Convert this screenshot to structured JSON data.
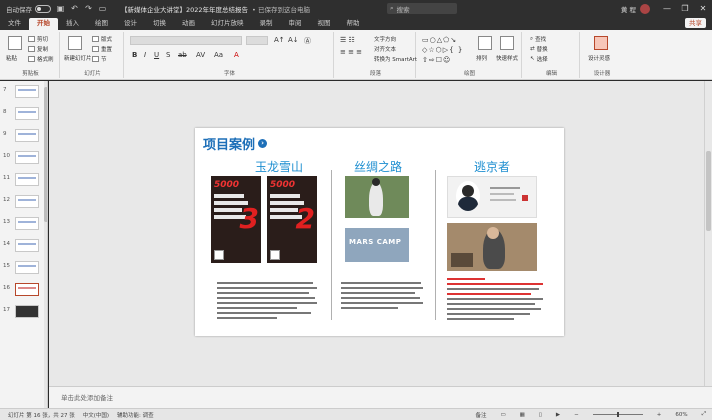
{
  "titlebar": {
    "autosave_label": "自动保存",
    "doc_title": "【新媒体企业大讲堂】2022年年度总结报告",
    "saved_label": "• 已保存到这台电脑",
    "search_placeholder": "搜索",
    "user_name": "黄 程",
    "minimize": "—",
    "restore": "❐",
    "close": "✕"
  },
  "tabs": [
    "文件",
    "开始",
    "插入",
    "绘图",
    "设计",
    "切换",
    "动画",
    "幻灯片放映",
    "录制",
    "审阅",
    "视图",
    "帮助"
  ],
  "active_tab": "开始",
  "share_label": "共享",
  "ribbon": {
    "clipboard": {
      "label": "剪贴板",
      "paste": "粘贴",
      "cut": "剪切",
      "copy": "复制",
      "format": "格式刷"
    },
    "slides": {
      "label": "幻灯片",
      "new_slide": "新建幻灯片",
      "layout": "版式",
      "reset": "重置",
      "section": "节"
    },
    "font": {
      "label": "字体"
    },
    "paragraph": {
      "label": "段落",
      "text_dir": "文字方向",
      "align": "对齐文本",
      "smartart": "转换为 SmartArt"
    },
    "drawing": {
      "label": "绘图",
      "arrange": "排列",
      "quick_styles": "快速样式"
    },
    "editing": {
      "label": "编辑",
      "find": "查找",
      "replace": "替换",
      "select": "选择"
    },
    "designer": {
      "label": "设计器",
      "ideas": "设计灵感"
    }
  },
  "slide": {
    "title": "项目案例",
    "columns": [
      "玉龙雪山",
      "丝绸之路",
      "逃京者"
    ],
    "poster_texts": [
      "5000",
      "5000"
    ],
    "poster_numbers": [
      "3",
      "2"
    ],
    "mars_camp": "MARS CAMP"
  },
  "thumbnails": [
    "7",
    "8",
    "9",
    "10",
    "11",
    "12",
    "13",
    "14",
    "15",
    "16",
    "17"
  ],
  "selected_thumbnail": "16",
  "notes_placeholder": "单击此处添加备注",
  "status": {
    "slide_info": "幻灯片 第 16 张，共 27 张",
    "language": "中文(中国)",
    "accessibility": "辅助功能: 调查",
    "notes": "备注",
    "zoom": "60%"
  }
}
